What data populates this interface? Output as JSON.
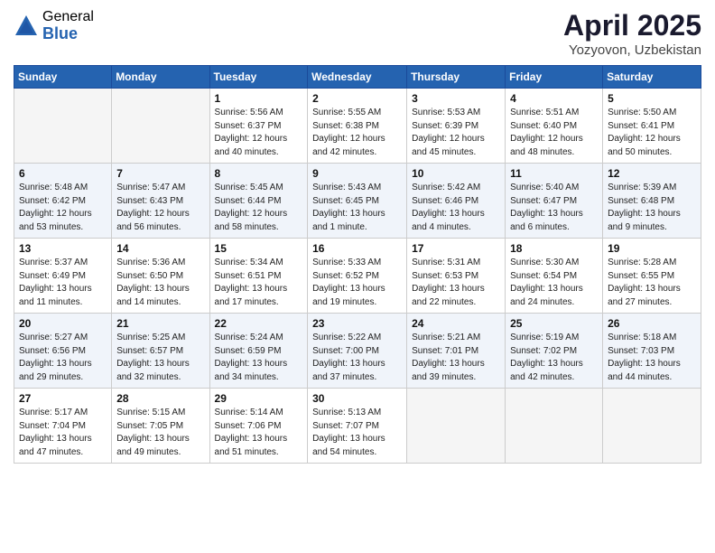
{
  "logo": {
    "general": "General",
    "blue": "Blue"
  },
  "title": {
    "month_year": "April 2025",
    "location": "Yozyovon, Uzbekistan"
  },
  "headers": [
    "Sunday",
    "Monday",
    "Tuesday",
    "Wednesday",
    "Thursday",
    "Friday",
    "Saturday"
  ],
  "weeks": [
    [
      {
        "day": "",
        "info": ""
      },
      {
        "day": "",
        "info": ""
      },
      {
        "day": "1",
        "info": "Sunrise: 5:56 AM\nSunset: 6:37 PM\nDaylight: 12 hours and 40 minutes."
      },
      {
        "day": "2",
        "info": "Sunrise: 5:55 AM\nSunset: 6:38 PM\nDaylight: 12 hours and 42 minutes."
      },
      {
        "day": "3",
        "info": "Sunrise: 5:53 AM\nSunset: 6:39 PM\nDaylight: 12 hours and 45 minutes."
      },
      {
        "day": "4",
        "info": "Sunrise: 5:51 AM\nSunset: 6:40 PM\nDaylight: 12 hours and 48 minutes."
      },
      {
        "day": "5",
        "info": "Sunrise: 5:50 AM\nSunset: 6:41 PM\nDaylight: 12 hours and 50 minutes."
      }
    ],
    [
      {
        "day": "6",
        "info": "Sunrise: 5:48 AM\nSunset: 6:42 PM\nDaylight: 12 hours and 53 minutes."
      },
      {
        "day": "7",
        "info": "Sunrise: 5:47 AM\nSunset: 6:43 PM\nDaylight: 12 hours and 56 minutes."
      },
      {
        "day": "8",
        "info": "Sunrise: 5:45 AM\nSunset: 6:44 PM\nDaylight: 12 hours and 58 minutes."
      },
      {
        "day": "9",
        "info": "Sunrise: 5:43 AM\nSunset: 6:45 PM\nDaylight: 13 hours and 1 minute."
      },
      {
        "day": "10",
        "info": "Sunrise: 5:42 AM\nSunset: 6:46 PM\nDaylight: 13 hours and 4 minutes."
      },
      {
        "day": "11",
        "info": "Sunrise: 5:40 AM\nSunset: 6:47 PM\nDaylight: 13 hours and 6 minutes."
      },
      {
        "day": "12",
        "info": "Sunrise: 5:39 AM\nSunset: 6:48 PM\nDaylight: 13 hours and 9 minutes."
      }
    ],
    [
      {
        "day": "13",
        "info": "Sunrise: 5:37 AM\nSunset: 6:49 PM\nDaylight: 13 hours and 11 minutes."
      },
      {
        "day": "14",
        "info": "Sunrise: 5:36 AM\nSunset: 6:50 PM\nDaylight: 13 hours and 14 minutes."
      },
      {
        "day": "15",
        "info": "Sunrise: 5:34 AM\nSunset: 6:51 PM\nDaylight: 13 hours and 17 minutes."
      },
      {
        "day": "16",
        "info": "Sunrise: 5:33 AM\nSunset: 6:52 PM\nDaylight: 13 hours and 19 minutes."
      },
      {
        "day": "17",
        "info": "Sunrise: 5:31 AM\nSunset: 6:53 PM\nDaylight: 13 hours and 22 minutes."
      },
      {
        "day": "18",
        "info": "Sunrise: 5:30 AM\nSunset: 6:54 PM\nDaylight: 13 hours and 24 minutes."
      },
      {
        "day": "19",
        "info": "Sunrise: 5:28 AM\nSunset: 6:55 PM\nDaylight: 13 hours and 27 minutes."
      }
    ],
    [
      {
        "day": "20",
        "info": "Sunrise: 5:27 AM\nSunset: 6:56 PM\nDaylight: 13 hours and 29 minutes."
      },
      {
        "day": "21",
        "info": "Sunrise: 5:25 AM\nSunset: 6:57 PM\nDaylight: 13 hours and 32 minutes."
      },
      {
        "day": "22",
        "info": "Sunrise: 5:24 AM\nSunset: 6:59 PM\nDaylight: 13 hours and 34 minutes."
      },
      {
        "day": "23",
        "info": "Sunrise: 5:22 AM\nSunset: 7:00 PM\nDaylight: 13 hours and 37 minutes."
      },
      {
        "day": "24",
        "info": "Sunrise: 5:21 AM\nSunset: 7:01 PM\nDaylight: 13 hours and 39 minutes."
      },
      {
        "day": "25",
        "info": "Sunrise: 5:19 AM\nSunset: 7:02 PM\nDaylight: 13 hours and 42 minutes."
      },
      {
        "day": "26",
        "info": "Sunrise: 5:18 AM\nSunset: 7:03 PM\nDaylight: 13 hours and 44 minutes."
      }
    ],
    [
      {
        "day": "27",
        "info": "Sunrise: 5:17 AM\nSunset: 7:04 PM\nDaylight: 13 hours and 47 minutes."
      },
      {
        "day": "28",
        "info": "Sunrise: 5:15 AM\nSunset: 7:05 PM\nDaylight: 13 hours and 49 minutes."
      },
      {
        "day": "29",
        "info": "Sunrise: 5:14 AM\nSunset: 7:06 PM\nDaylight: 13 hours and 51 minutes."
      },
      {
        "day": "30",
        "info": "Sunrise: 5:13 AM\nSunset: 7:07 PM\nDaylight: 13 hours and 54 minutes."
      },
      {
        "day": "",
        "info": ""
      },
      {
        "day": "",
        "info": ""
      },
      {
        "day": "",
        "info": ""
      }
    ]
  ]
}
